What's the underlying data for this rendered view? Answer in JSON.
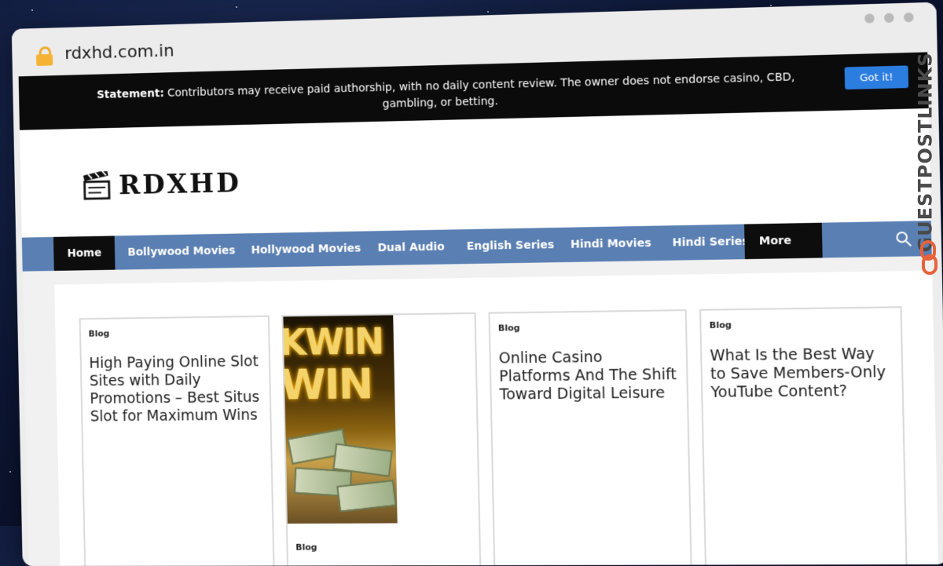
{
  "browser": {
    "url": "rdxhd.com.in"
  },
  "notice": {
    "label": "Statement:",
    "text": "Contributors may receive paid authorship, with no daily content review. The owner does not endorse casino, CBD, gambling, or betting.",
    "button": "Got it!"
  },
  "site": {
    "logo_text": "RDXHD"
  },
  "nav": {
    "items": [
      "Home",
      "Bollywood Movies",
      "Hollywood Movies",
      "Dual Audio",
      "English Series",
      "Hindi Movies",
      "Hindi Series"
    ],
    "more": "More",
    "active_index": 0
  },
  "cards": [
    {
      "category": "Blog",
      "title": "High Paying Online Slot Sites with Daily Promotions – Best Situs Slot for Maximum Wins"
    },
    {
      "category": "Blog",
      "title": "",
      "image_text": "KWIN WIN"
    },
    {
      "category": "Blog",
      "title": "Online Casino Platforms And The Shift Toward Digital Leisure"
    },
    {
      "category": "Blog",
      "title": "What Is the Best Way to Save Members-Only YouTube Content?"
    }
  ],
  "watermark": "GUESTPOSTLINKS",
  "colors": {
    "nav_bg": "#5a7fb3",
    "nav_active": "#0d0d0d",
    "button": "#2c7de0",
    "notice_bg": "#0b0b0b"
  }
}
